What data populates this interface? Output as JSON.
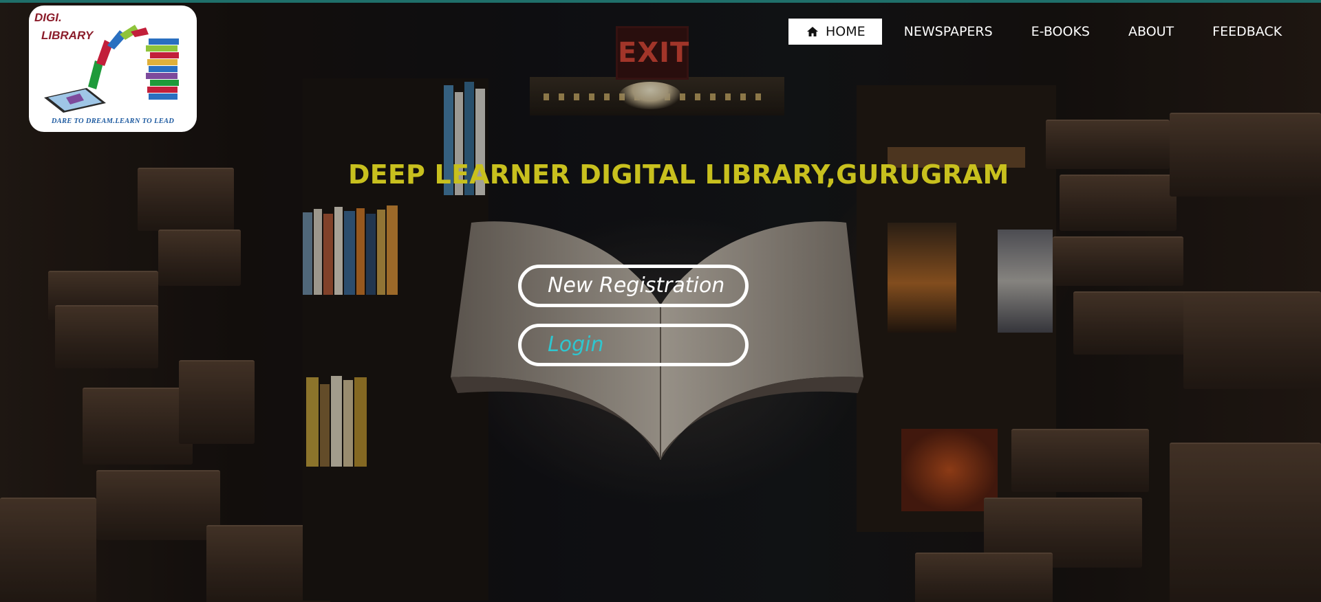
{
  "brand": {
    "logo_line1": "DIGI.",
    "logo_line2": "LIBRARY",
    "logo_tagline": "DARE TO DREAM.LEARN TO LEAD"
  },
  "background": {
    "sign_text": "EXIT"
  },
  "nav": {
    "items": [
      {
        "label": "HOME",
        "icon": "home-icon",
        "active": true
      },
      {
        "label": "NEWSPAPERS",
        "active": false
      },
      {
        "label": "E-BOOKS",
        "active": false
      },
      {
        "label": "ABOUT",
        "active": false
      },
      {
        "label": "FEEDBACK",
        "active": false
      }
    ]
  },
  "main": {
    "title": "DEEP LEARNER DIGITAL LIBRARY,GURUGRAM",
    "register_label": "New Registration",
    "login_label": "Login"
  },
  "colors": {
    "title": "#c8c01e",
    "login_text": "#2fc6cf",
    "top_border": "#1f6f6a",
    "logo_text": "#8b1c2a",
    "logo_tagline": "#1d5aa0"
  }
}
